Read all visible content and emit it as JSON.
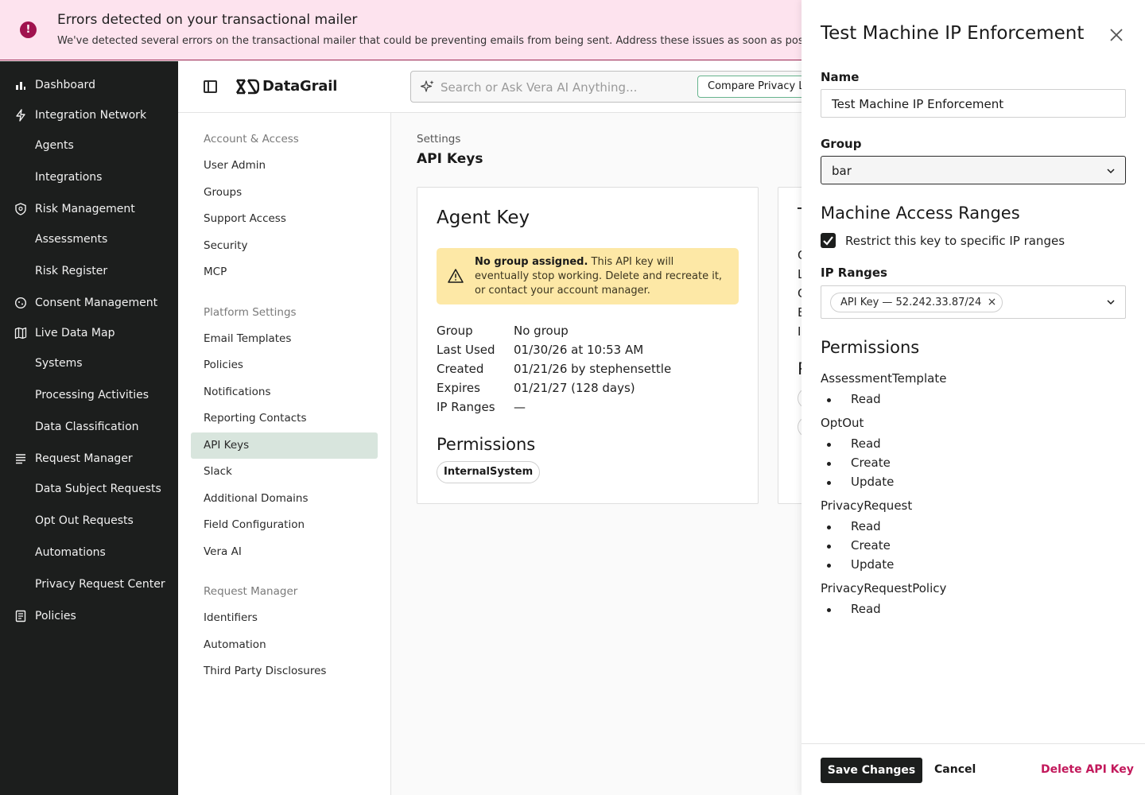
{
  "banner": {
    "title": "Errors detected on your transactional mailer",
    "message": "We've detected several errors on the transactional mailer that could be preventing emails from being sent. Address these issues as soon as poss",
    "icon": "alert-circle-icon"
  },
  "nav": {
    "items": [
      {
        "label": "Dashboard",
        "icon": "bar-chart-icon"
      },
      {
        "label": "Integration Network",
        "icon": "lightning-icon"
      },
      {
        "label": "Agents",
        "icon": ""
      },
      {
        "label": "Integrations",
        "icon": ""
      },
      {
        "label": "Risk Management",
        "icon": "shield-icon"
      },
      {
        "label": "Assessments",
        "icon": ""
      },
      {
        "label": "Risk Register",
        "icon": ""
      },
      {
        "label": "Consent Management",
        "icon": "consent-icon"
      },
      {
        "label": "Live Data Map",
        "icon": "map-icon"
      },
      {
        "label": "Systems",
        "icon": ""
      },
      {
        "label": "Processing Activities",
        "icon": ""
      },
      {
        "label": "Data Classification",
        "icon": ""
      },
      {
        "label": "Request Manager",
        "icon": "list-icon"
      },
      {
        "label": "Data Subject Requests",
        "icon": ""
      },
      {
        "label": "Opt Out Requests",
        "icon": ""
      },
      {
        "label": "Automations",
        "icon": ""
      },
      {
        "label": "Privacy Request Center",
        "icon": ""
      },
      {
        "label": "Policies",
        "icon": "document-icon"
      }
    ]
  },
  "header": {
    "logo_text": "DataGrail",
    "search_placeholder": "Search or Ask Vera AI Anything...",
    "compare_label": "Compare Privacy L"
  },
  "subnav": {
    "sections": [
      {
        "heading": "Account & Access",
        "items": [
          "User Admin",
          "Groups",
          "Support Access",
          "Security",
          "MCP"
        ]
      },
      {
        "heading": "Platform Settings",
        "items": [
          "Email Templates",
          "Policies",
          "Notifications",
          "Reporting Contacts",
          "API Keys",
          "Slack",
          "Additional Domains",
          "Field Configuration",
          "Vera AI"
        ]
      },
      {
        "heading": "Request Manager",
        "items": [
          "Identifiers",
          "Automation",
          "Third Party Disclosures"
        ]
      }
    ],
    "active": "API Keys"
  },
  "main": {
    "breadcrumb": "Settings",
    "title": "API Keys",
    "card": {
      "title": "Agent Key",
      "warning_bold": "No group assigned.",
      "warning_text": " This API key will eventually stop working. Delete and recreate it, or contact your account manager.",
      "fields": [
        {
          "key": "Group",
          "value": "No group"
        },
        {
          "key": "Last Used",
          "value": "01/30/26 at 10:53 AM"
        },
        {
          "key": "Created",
          "value": "01/21/26 by stephensettle"
        },
        {
          "key": "Expires",
          "value": "01/21/27 (128 days)"
        },
        {
          "key": "IP Ranges",
          "value": "—"
        }
      ],
      "permissions_title": "Permissions",
      "permissions": [
        "InternalSystem"
      ]
    },
    "card2_fragments": [
      "T",
      "C",
      "L",
      "C",
      "E",
      "I",
      "P"
    ]
  },
  "drawer": {
    "title": "Test Machine IP Enforcement",
    "name_label": "Name",
    "name_value": "Test Machine IP Enforcement",
    "group_label": "Group",
    "group_value": "bar",
    "access_title": "Machine Access Ranges",
    "restrict_label": "Restrict this key to specific IP ranges",
    "restrict_checked": true,
    "ip_label": "IP Ranges",
    "ip_tags": [
      "API Key — 52.242.33.87/24"
    ],
    "permissions_title": "Permissions",
    "permissions": [
      {
        "resource": "AssessmentTemplate",
        "actions": [
          "Read"
        ]
      },
      {
        "resource": "OptOut",
        "actions": [
          "Read",
          "Create",
          "Update"
        ]
      },
      {
        "resource": "PrivacyRequest",
        "actions": [
          "Read",
          "Create",
          "Update"
        ]
      },
      {
        "resource": "PrivacyRequestPolicy",
        "actions": [
          "Read"
        ]
      }
    ],
    "save_label": "Save Changes",
    "cancel_label": "Cancel",
    "delete_label": "Delete API Key"
  },
  "colors": {
    "banner_bg": "#fde3ee",
    "nav_bg": "#1c1e1d",
    "active_subnav": "#d8e5dd",
    "warning_bg": "#fde8a6",
    "delete_text": "#c2185b"
  }
}
